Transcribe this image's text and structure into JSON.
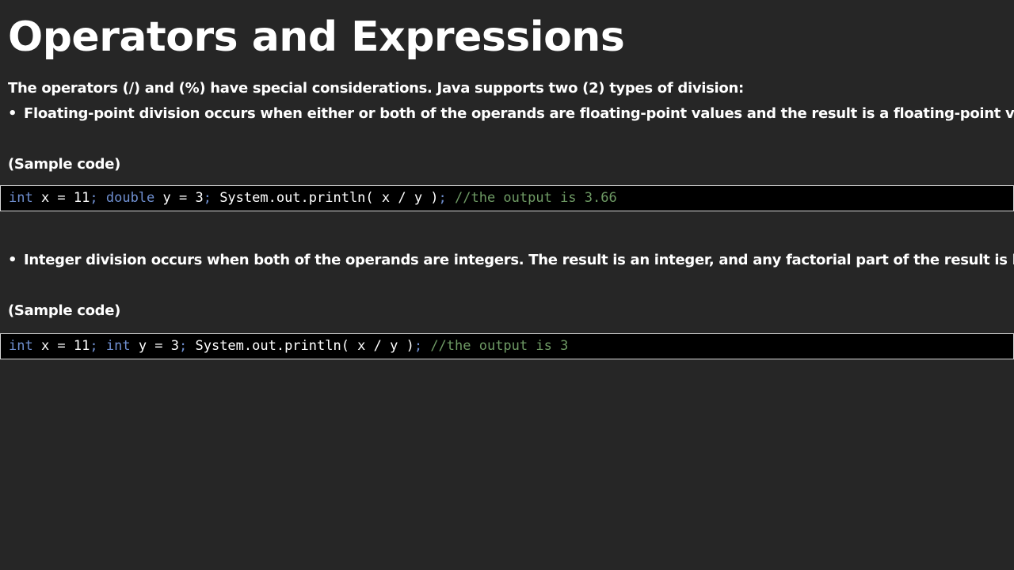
{
  "slide": {
    "title": "Operators and Expressions",
    "intro": "The operators (/) and (%) have special considerations. Java supports two (2) types of division:",
    "bullet_glyph": "•",
    "bullet1": "Floating-point division occurs when either or both of the operands are floating-point values and the result is a floating-point value.",
    "sample_label_1": "(Sample code)",
    "code1": {
      "kw1": "int",
      "p1": " x = 11",
      "s1": ";",
      "kw2": " double",
      "p2": " y = 3",
      "s2": ";",
      "p3": " System.out.println( x / y )",
      "s3": ";",
      "comment": " //the output is 3.66"
    },
    "bullet2": "Integer division occurs when both of the operands are integers. The result is an integer, and any factorial part of the result is lost.",
    "sample_label_2": "(Sample code)",
    "code2": {
      "kw1": "int",
      "p1": " x = 11",
      "s1": ";",
      "kw2": " int",
      "p2": " y = 3",
      "s2": ";",
      "p3": " System.out.println( x / y )",
      "s3": ";",
      "comment": " //the output is 3"
    }
  },
  "colors": {
    "background": "#262626",
    "keyword": "#6f8fd0",
    "comment": "#6e9a64",
    "code_background": "#000000"
  }
}
